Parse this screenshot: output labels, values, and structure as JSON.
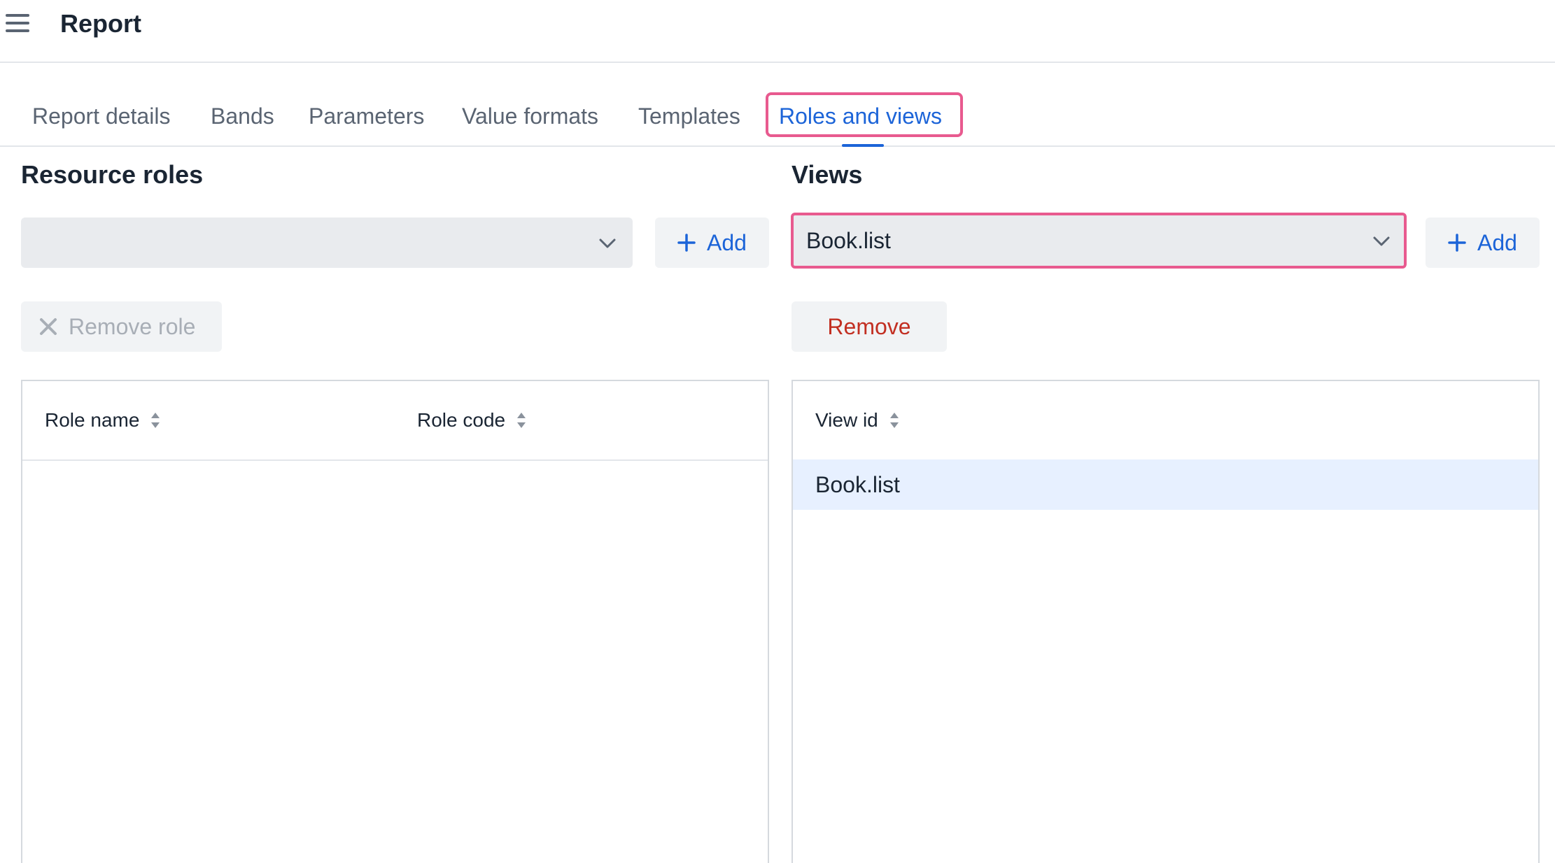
{
  "header": {
    "title": "Report",
    "menu_icon": "hamburger-menu-icon"
  },
  "tabs": [
    {
      "label": "Report details",
      "active": false
    },
    {
      "label": "Bands",
      "active": false
    },
    {
      "label": "Parameters",
      "active": false
    },
    {
      "label": "Value formats",
      "active": false
    },
    {
      "label": "Templates",
      "active": false
    },
    {
      "label": "Roles and views",
      "active": true
    }
  ],
  "roles": {
    "title": "Resource roles",
    "select_value": "",
    "add_label": "Add",
    "remove_label": "Remove role",
    "columns": [
      "Role name",
      "Role code"
    ],
    "rows": []
  },
  "views": {
    "title": "Views",
    "select_value": "Book.list",
    "add_label": "Add",
    "remove_label": "Remove",
    "columns": [
      "View id"
    ],
    "rows": [
      {
        "view_id": "Book.list",
        "selected": true
      }
    ]
  },
  "colors": {
    "accent": "#1c64d8",
    "focus_ring": "#e85a8f",
    "danger": "#c22f22",
    "selected_row": "#e7f0ff"
  }
}
